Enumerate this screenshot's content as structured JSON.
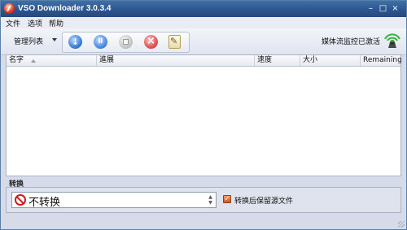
{
  "window": {
    "title": "VSO Downloader 3.0.3.4",
    "controls": {
      "minimize": "–",
      "maximize": "□",
      "close": "×"
    }
  },
  "menu": [
    "文件",
    "选项",
    "帮助"
  ],
  "toolbar": {
    "manage_label": "管理列表",
    "buttons": [
      "download-icon",
      "pause-icon",
      "stop-icon",
      "delete-icon",
      "properties-icon"
    ],
    "monitor_status": "媒体流监控已激活"
  },
  "list": {
    "columns": [
      "名字",
      "進展",
      "速度",
      "大小",
      "Remaining"
    ],
    "rows": []
  },
  "convert": {
    "section_label": "转换",
    "selected_option": "不转换",
    "keep_source_label": "转换后保留源文件",
    "keep_source_checked": true
  },
  "colors": {
    "titlebar": "#2c5690",
    "accent_checkbox": "#d2521b",
    "no_convert_icon": "#cc1b1b"
  }
}
